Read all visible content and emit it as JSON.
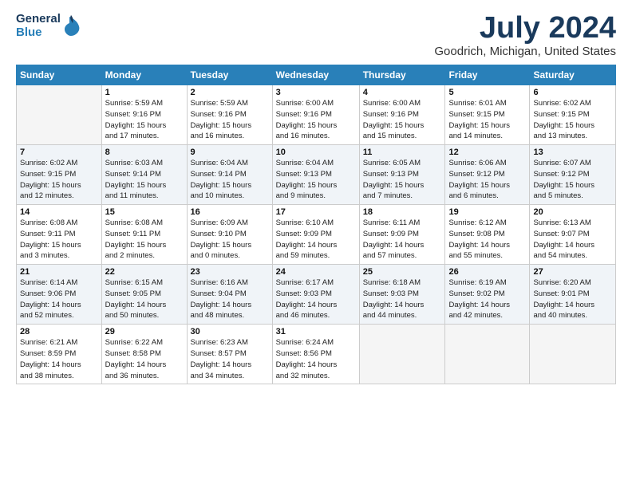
{
  "header": {
    "logo_line1": "General",
    "logo_line2": "Blue",
    "title": "July 2024",
    "subtitle": "Goodrich, Michigan, United States"
  },
  "calendar": {
    "days_of_week": [
      "Sunday",
      "Monday",
      "Tuesday",
      "Wednesday",
      "Thursday",
      "Friday",
      "Saturday"
    ],
    "weeks": [
      [
        {
          "day": "",
          "info": ""
        },
        {
          "day": "1",
          "info": "Sunrise: 5:59 AM\nSunset: 9:16 PM\nDaylight: 15 hours\nand 17 minutes."
        },
        {
          "day": "2",
          "info": "Sunrise: 5:59 AM\nSunset: 9:16 PM\nDaylight: 15 hours\nand 16 minutes."
        },
        {
          "day": "3",
          "info": "Sunrise: 6:00 AM\nSunset: 9:16 PM\nDaylight: 15 hours\nand 16 minutes."
        },
        {
          "day": "4",
          "info": "Sunrise: 6:00 AM\nSunset: 9:16 PM\nDaylight: 15 hours\nand 15 minutes."
        },
        {
          "day": "5",
          "info": "Sunrise: 6:01 AM\nSunset: 9:15 PM\nDaylight: 15 hours\nand 14 minutes."
        },
        {
          "day": "6",
          "info": "Sunrise: 6:02 AM\nSunset: 9:15 PM\nDaylight: 15 hours\nand 13 minutes."
        }
      ],
      [
        {
          "day": "7",
          "info": "Sunrise: 6:02 AM\nSunset: 9:15 PM\nDaylight: 15 hours\nand 12 minutes."
        },
        {
          "day": "8",
          "info": "Sunrise: 6:03 AM\nSunset: 9:14 PM\nDaylight: 15 hours\nand 11 minutes."
        },
        {
          "day": "9",
          "info": "Sunrise: 6:04 AM\nSunset: 9:14 PM\nDaylight: 15 hours\nand 10 minutes."
        },
        {
          "day": "10",
          "info": "Sunrise: 6:04 AM\nSunset: 9:13 PM\nDaylight: 15 hours\nand 9 minutes."
        },
        {
          "day": "11",
          "info": "Sunrise: 6:05 AM\nSunset: 9:13 PM\nDaylight: 15 hours\nand 7 minutes."
        },
        {
          "day": "12",
          "info": "Sunrise: 6:06 AM\nSunset: 9:12 PM\nDaylight: 15 hours\nand 6 minutes."
        },
        {
          "day": "13",
          "info": "Sunrise: 6:07 AM\nSunset: 9:12 PM\nDaylight: 15 hours\nand 5 minutes."
        }
      ],
      [
        {
          "day": "14",
          "info": "Sunrise: 6:08 AM\nSunset: 9:11 PM\nDaylight: 15 hours\nand 3 minutes."
        },
        {
          "day": "15",
          "info": "Sunrise: 6:08 AM\nSunset: 9:11 PM\nDaylight: 15 hours\nand 2 minutes."
        },
        {
          "day": "16",
          "info": "Sunrise: 6:09 AM\nSunset: 9:10 PM\nDaylight: 15 hours\nand 0 minutes."
        },
        {
          "day": "17",
          "info": "Sunrise: 6:10 AM\nSunset: 9:09 PM\nDaylight: 14 hours\nand 59 minutes."
        },
        {
          "day": "18",
          "info": "Sunrise: 6:11 AM\nSunset: 9:09 PM\nDaylight: 14 hours\nand 57 minutes."
        },
        {
          "day": "19",
          "info": "Sunrise: 6:12 AM\nSunset: 9:08 PM\nDaylight: 14 hours\nand 55 minutes."
        },
        {
          "day": "20",
          "info": "Sunrise: 6:13 AM\nSunset: 9:07 PM\nDaylight: 14 hours\nand 54 minutes."
        }
      ],
      [
        {
          "day": "21",
          "info": "Sunrise: 6:14 AM\nSunset: 9:06 PM\nDaylight: 14 hours\nand 52 minutes."
        },
        {
          "day": "22",
          "info": "Sunrise: 6:15 AM\nSunset: 9:05 PM\nDaylight: 14 hours\nand 50 minutes."
        },
        {
          "day": "23",
          "info": "Sunrise: 6:16 AM\nSunset: 9:04 PM\nDaylight: 14 hours\nand 48 minutes."
        },
        {
          "day": "24",
          "info": "Sunrise: 6:17 AM\nSunset: 9:03 PM\nDaylight: 14 hours\nand 46 minutes."
        },
        {
          "day": "25",
          "info": "Sunrise: 6:18 AM\nSunset: 9:03 PM\nDaylight: 14 hours\nand 44 minutes."
        },
        {
          "day": "26",
          "info": "Sunrise: 6:19 AM\nSunset: 9:02 PM\nDaylight: 14 hours\nand 42 minutes."
        },
        {
          "day": "27",
          "info": "Sunrise: 6:20 AM\nSunset: 9:01 PM\nDaylight: 14 hours\nand 40 minutes."
        }
      ],
      [
        {
          "day": "28",
          "info": "Sunrise: 6:21 AM\nSunset: 8:59 PM\nDaylight: 14 hours\nand 38 minutes."
        },
        {
          "day": "29",
          "info": "Sunrise: 6:22 AM\nSunset: 8:58 PM\nDaylight: 14 hours\nand 36 minutes."
        },
        {
          "day": "30",
          "info": "Sunrise: 6:23 AM\nSunset: 8:57 PM\nDaylight: 14 hours\nand 34 minutes."
        },
        {
          "day": "31",
          "info": "Sunrise: 6:24 AM\nSunset: 8:56 PM\nDaylight: 14 hours\nand 32 minutes."
        },
        {
          "day": "",
          "info": ""
        },
        {
          "day": "",
          "info": ""
        },
        {
          "day": "",
          "info": ""
        }
      ]
    ]
  }
}
